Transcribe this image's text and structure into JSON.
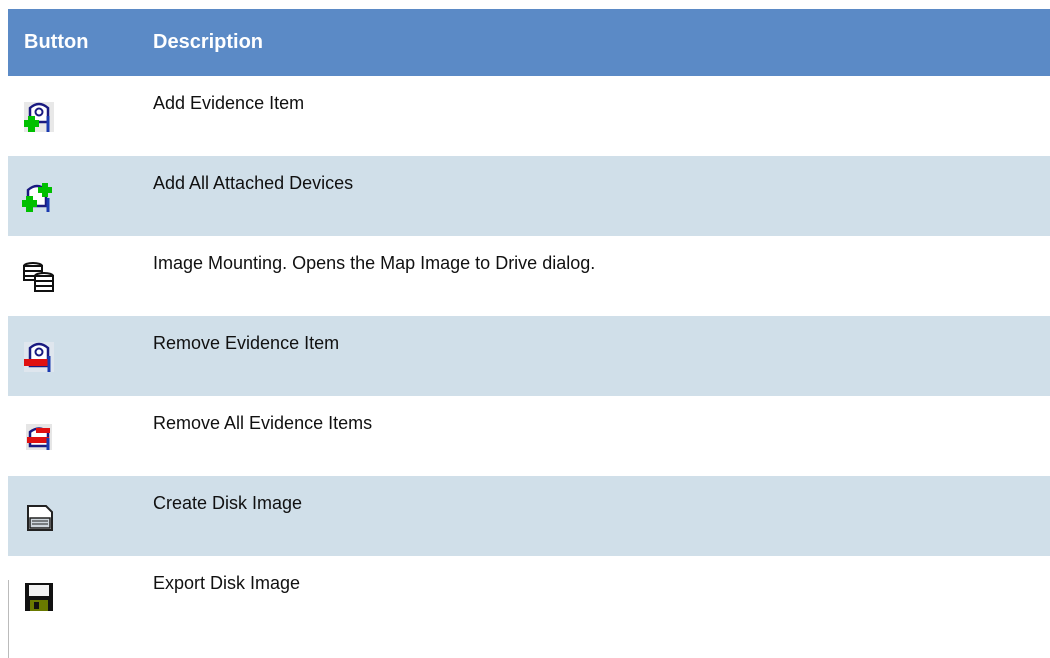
{
  "table": {
    "headers": {
      "button": "Button",
      "description": "Description"
    },
    "rows": [
      {
        "icon": "add-evidence-icon",
        "description": "Add Evidence Item"
      },
      {
        "icon": "add-devices-icon",
        "description": "Add All Attached Devices"
      },
      {
        "icon": "image-mounting-icon",
        "description": "Image Mounting. Opens the Map Image to Drive dialog."
      },
      {
        "icon": "remove-evidence-icon",
        "description": "Remove Evidence Item"
      },
      {
        "icon": "remove-all-evidence-icon",
        "description": "Remove All Evidence Items"
      },
      {
        "icon": "create-disk-image-icon",
        "description": "Create Disk Image"
      },
      {
        "icon": "export-disk-image-icon",
        "description": "Export Disk Image"
      }
    ]
  },
  "colors": {
    "header": "#5b8ac6",
    "alt_row": "#d0dfe9",
    "header_text": "#ffffff"
  }
}
